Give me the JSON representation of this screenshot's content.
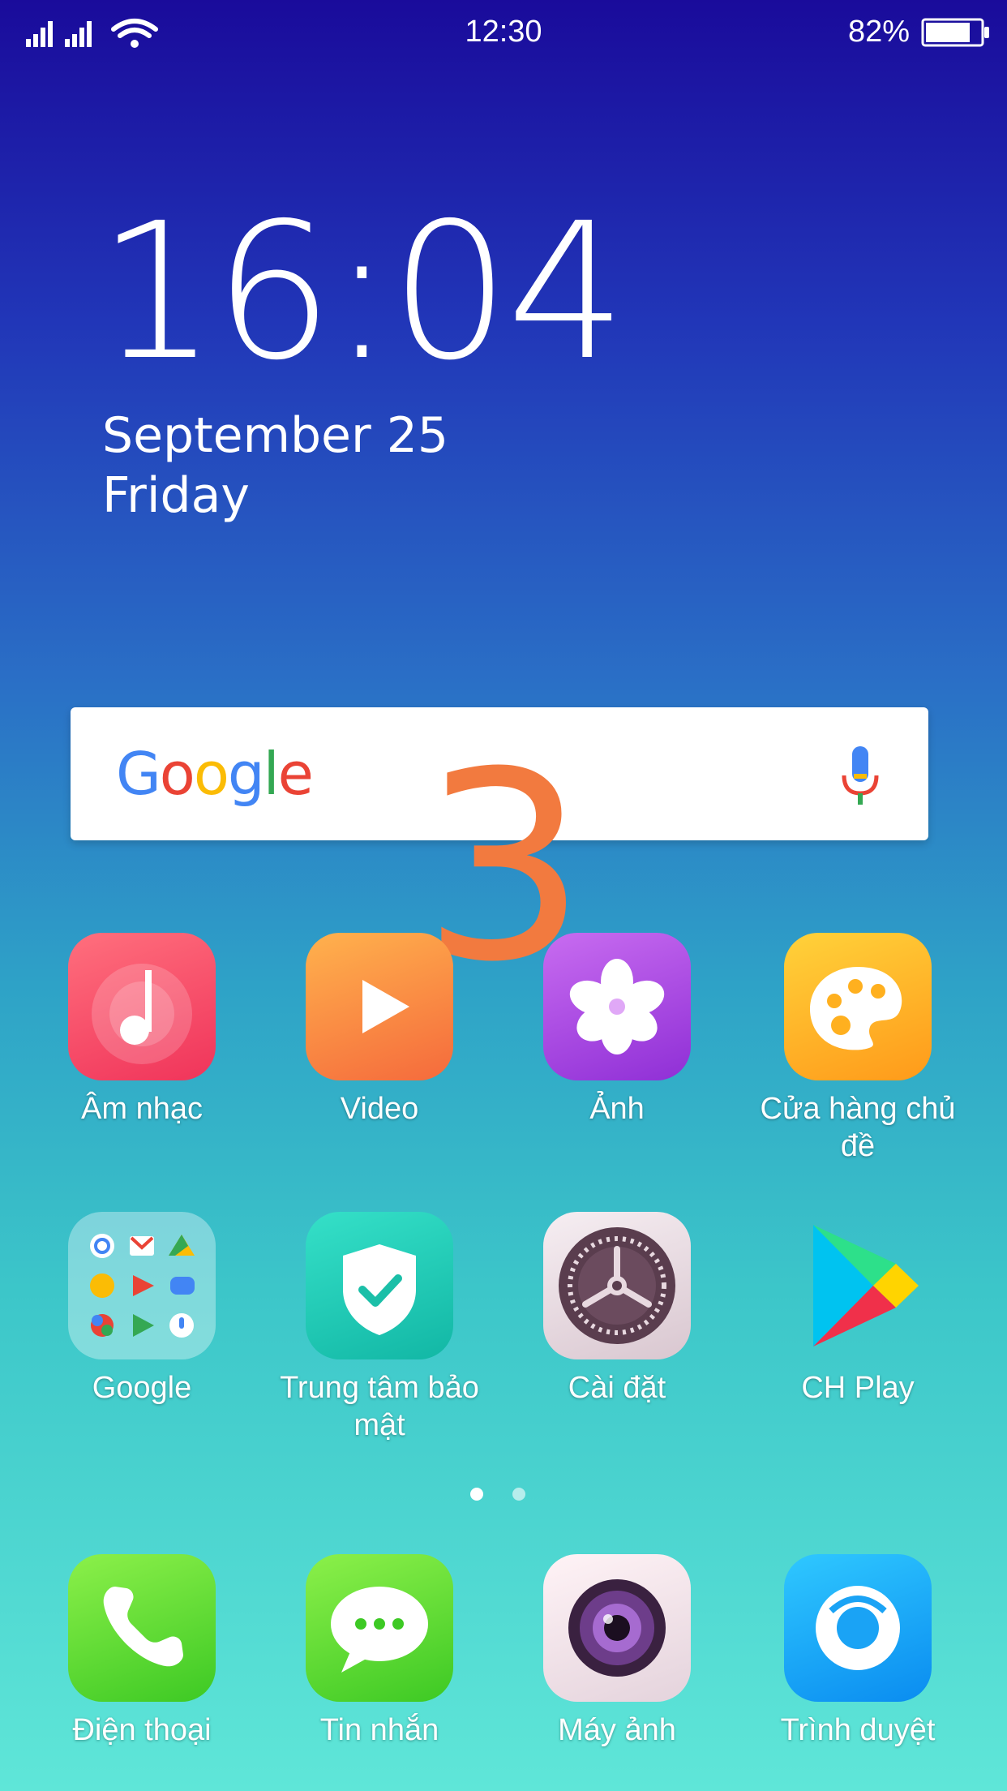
{
  "status_bar": {
    "time": "12:30",
    "battery_percent": "82%",
    "battery_level": 0.82,
    "signal_icon": "signal-icon",
    "wifi_icon": "wifi-icon",
    "battery_icon": "battery-icon"
  },
  "clock": {
    "time": "16:04",
    "date": "September 25",
    "day": "Friday"
  },
  "search": {
    "logo": "Google",
    "logo_colors": [
      "#4285F4",
      "#EA4335",
      "#FBBC05",
      "#4285F4",
      "#34A853",
      "#EA4335"
    ],
    "mic_icon": "mic-icon"
  },
  "overlay_number": "3",
  "overlay_color": "#f27a3f",
  "apps_row1": [
    {
      "label": "Âm nhạc",
      "icon": "music-icon"
    },
    {
      "label": "Video",
      "icon": "video-play-icon"
    },
    {
      "label": "Ảnh",
      "icon": "flower-photo-icon"
    },
    {
      "label": "Cửa hàng chủ đề",
      "icon": "theme-palette-icon"
    }
  ],
  "apps_row2": [
    {
      "label": "Google",
      "icon": "google-folder-icon"
    },
    {
      "label": "Trung tâm bảo mật",
      "icon": "security-shield-icon"
    },
    {
      "label": "Cài đặt",
      "icon": "settings-gear-icon"
    },
    {
      "label": "CH Play",
      "icon": "play-store-icon"
    }
  ],
  "page_indicator": {
    "pages": 2,
    "current": 1
  },
  "dock": [
    {
      "label": "Điện thoại",
      "icon": "phone-icon"
    },
    {
      "label": "Tin nhắn",
      "icon": "message-icon"
    },
    {
      "label": "Máy ảnh",
      "icon": "camera-icon"
    },
    {
      "label": "Trình duyệt",
      "icon": "browser-icon"
    }
  ]
}
